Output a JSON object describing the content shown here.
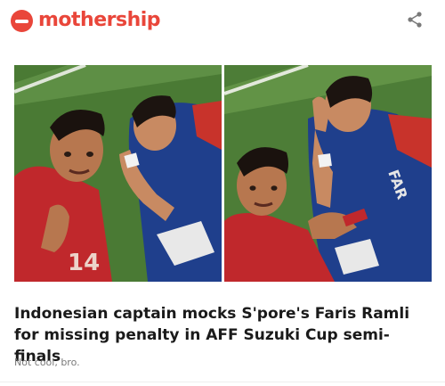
{
  "header": {
    "brand": "mothership",
    "brand_color": "#e9463a",
    "logo_icon": "mothership-logo-icon",
    "share_icon": "share-icon"
  },
  "article": {
    "title": "Indonesian captain mocks S'pore's Faris Ramli for missing penalty in AFF Suzuki Cup semi-finals",
    "subtitle": "Not cool, bro.",
    "image_panels": 2
  }
}
